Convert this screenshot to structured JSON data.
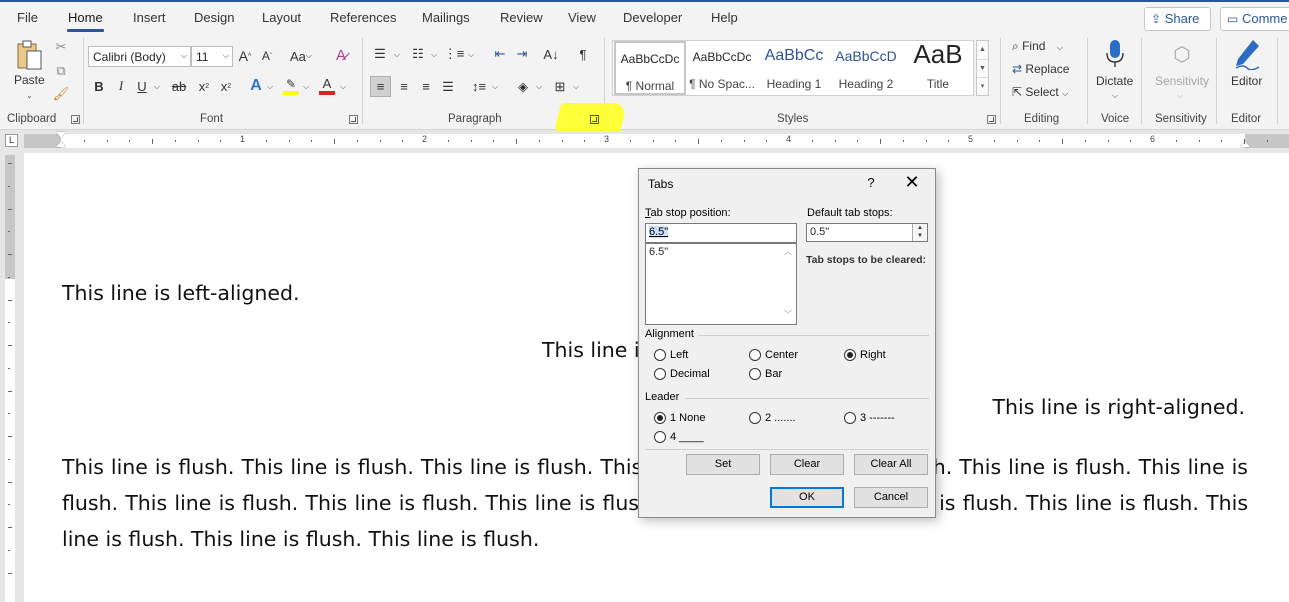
{
  "menu": {
    "tabs": [
      "File",
      "Home",
      "Insert",
      "Design",
      "Layout",
      "References",
      "Mailings",
      "Review",
      "View",
      "Developer",
      "Help"
    ],
    "active": "Home",
    "share_label": "Share",
    "comments_label": "Comme"
  },
  "ribbon": {
    "clipboard": {
      "paste_label": "Paste",
      "group_label": "Clipboard"
    },
    "font": {
      "font_name": "Calibri (Body)",
      "font_size": "11",
      "case_label": "Aa",
      "bold": "B",
      "italic": "I",
      "underline": "U",
      "strike": "ab",
      "subscript": "x",
      "superscript": "x",
      "group_label": "Font"
    },
    "paragraph": {
      "group_label": "Paragraph"
    },
    "styles": {
      "items": [
        {
          "sample": "AaBbCcDc",
          "name": "¶ Normal"
        },
        {
          "sample": "AaBbCcDc",
          "name": "¶ No Spac..."
        },
        {
          "sample": "AaBbCc",
          "name": "Heading 1"
        },
        {
          "sample": "AaBbCcD",
          "name": "Heading 2"
        },
        {
          "sample": "AaB",
          "name": "Title"
        }
      ],
      "group_label": "Styles"
    },
    "editing": {
      "find_label": "Find",
      "replace_label": "Replace",
      "select_label": "Select",
      "group_label": "Editing"
    },
    "voice": {
      "dictate_label": "Dictate",
      "group_label": "Voice"
    },
    "sensitivity": {
      "button_label": "Sensitivity",
      "group_label": "Sensitivity"
    },
    "editor": {
      "button_label": "Editor",
      "group_label": "Editor"
    }
  },
  "ruler": {
    "numbers": [
      "1",
      "2",
      "3",
      "4",
      "5",
      "6"
    ],
    "tab_selector": "L"
  },
  "document": {
    "left_line": "This line is left-aligned.",
    "center_line": "This line is centered.",
    "right_line": "This line is right-aligned.",
    "flush_paragraph": "This line is flush. This line is flush. This line is flush. This line is flush. This line is flush. This line is flush. This line is flush. This line is flush. This line is flush. This line is flush. This line is flush. This line is flush. This line is flush. This line is flush. This line is flush. This line is flush."
  },
  "dialog": {
    "title": "Tabs",
    "help": "?",
    "close": "✕",
    "tab_stop_label": "Tab stop position:",
    "tab_stop_value": "6.5\"",
    "list_items": [
      "6.5\""
    ],
    "default_label": "Default tab stops:",
    "default_value": "0.5\"",
    "to_clear_label": "Tab stops to be cleared:",
    "alignment_label": "Alignment",
    "alignment_options": [
      "Left",
      "Center",
      "Right",
      "Decimal",
      "Bar"
    ],
    "alignment_selected": "Right",
    "leader_label": "Leader",
    "leader_options": [
      "1 None",
      "2 .......",
      "3 -------",
      "4 ____"
    ],
    "leader_selected": "1 None",
    "set_label": "Set",
    "clear_label": "Clear",
    "clear_all_label": "Clear All",
    "ok_label": "OK",
    "cancel_label": "Cancel"
  },
  "colors": {
    "accent": "#2b579a",
    "highlight_mark": "#ffff2e",
    "font_color_bar": "#e02020",
    "highlight_bar": "#ffff00"
  }
}
